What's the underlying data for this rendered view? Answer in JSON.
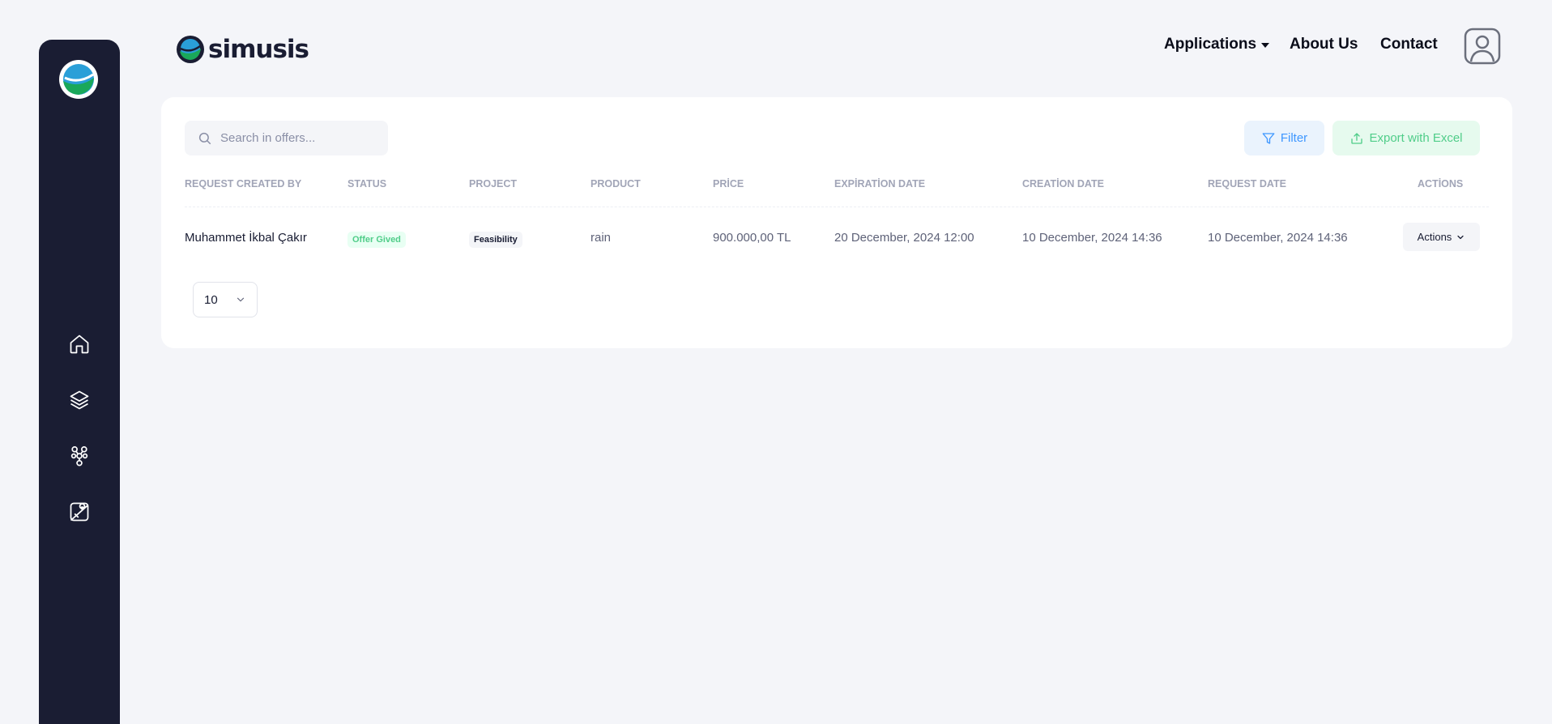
{
  "brand": {
    "name": "simusis"
  },
  "topnav": {
    "applications": "Applications",
    "about": "About Us",
    "contact": "Contact"
  },
  "search": {
    "placeholder": "Search in offers..."
  },
  "toolbar": {
    "filter": "Filter",
    "export": "Export with Excel"
  },
  "table": {
    "headers": [
      "REQUEST CREATED BY",
      "STATUS",
      "PROJECT",
      "PRODUCT",
      "PRİCE",
      "EXPİRATİON DATE",
      "CREATİON DATE",
      "REQUEST DATE",
      "ACTİONS"
    ],
    "rows": [
      {
        "created_by": "Muhammet İkbal Çakır",
        "status": "Offer Gived",
        "project": "Feasibility",
        "product": "rain",
        "price": "900.000,00 TL",
        "expiration": "20 December, 2024 12:00",
        "creation": "10 December, 2024 14:36",
        "request": "10 December, 2024 14:36",
        "actions": "Actions"
      }
    ]
  },
  "pagination": {
    "page_size": "10"
  },
  "sidebar": {
    "icons": [
      "home-icon",
      "layers-icon",
      "network-icon",
      "map-pin-icon"
    ]
  },
  "colors": {
    "sidebar_bg": "#1a1d33",
    "filter_accent": "#3e97ff",
    "export_accent": "#50cd89",
    "status_success": "#50cd89"
  }
}
